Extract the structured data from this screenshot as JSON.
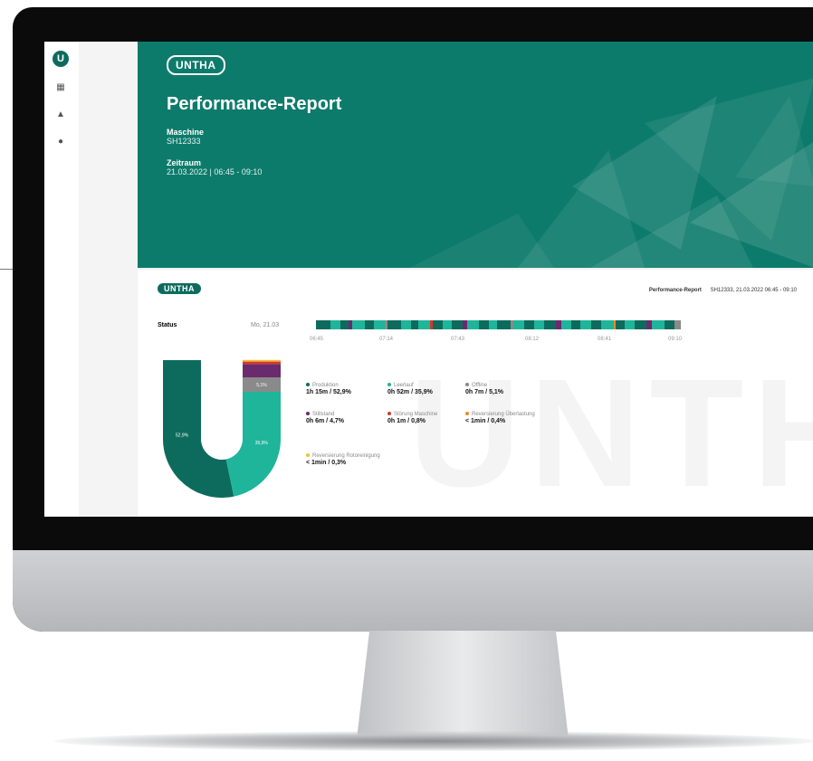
{
  "sidebar": {
    "logo": "U",
    "items": [
      {
        "icon": "grid-icon",
        "glyph": "▦"
      },
      {
        "icon": "bell-icon",
        "glyph": "▲"
      },
      {
        "icon": "help-icon",
        "glyph": "●"
      }
    ]
  },
  "header": {
    "brand": "UNTHA",
    "title": "Performance-Report",
    "machine_label": "Maschine",
    "machine_value": "SH12333",
    "period_label": "Zeitraum",
    "period_value": "21.03.2022 | 06:45 - 09:10"
  },
  "report": {
    "brand": "UNTHA",
    "header_title": "Performance-Report",
    "header_meta": "SH12333, 21.03.2022 06:45 - 09:10",
    "status_label": "Status",
    "status_date": "Mo, 21.03",
    "time_ticks": [
      "06:45",
      "07:14",
      "07:43",
      "08:12",
      "08:41",
      "09:10"
    ],
    "watermark": "UNTH"
  },
  "colors": {
    "produktion": "#0d6b5d",
    "leerlauf": "#1fb59a",
    "offline": "#8a8a8a",
    "stillstand": "#6a2a6e",
    "stoerung": "#d0392b",
    "reversierung_ueberlastung": "#f08a24",
    "reversierung_rotor": "#f2c23a"
  },
  "chart_data": {
    "type": "bar",
    "title": "",
    "segments": [
      {
        "name": "Produktion",
        "duration": "1h 15m",
        "percent": 52.9,
        "label": "52,9%"
      },
      {
        "name": "Leerlauf",
        "duration": "0h 52m",
        "percent": 35.9,
        "label": "35,9%"
      },
      {
        "name": "Offline",
        "duration": "0h 7m",
        "percent": 5.1,
        "label": "5,1%"
      },
      {
        "name": "Stillstand",
        "duration": "0h 6m",
        "percent": 4.7,
        "label": ""
      },
      {
        "name": "Störung Maschine",
        "duration": "0h 1m",
        "percent": 0.8,
        "label": ""
      },
      {
        "name": "Reversierung Überlastung",
        "duration": "< 1min",
        "percent": 0.4,
        "label": ""
      },
      {
        "name": "Reversierung Rotoreinigung",
        "duration": "< 1min",
        "percent": 0.3,
        "label": ""
      }
    ]
  },
  "legend": [
    {
      "name": "Produktion",
      "value": "1h 15m / 52,9%",
      "color_key": "produktion"
    },
    {
      "name": "Leerlauf",
      "value": "0h 52m / 35,9%",
      "color_key": "leerlauf"
    },
    {
      "name": "Offline",
      "value": "0h 7m / 5,1%",
      "color_key": "offline"
    },
    {
      "name": "Stillstand",
      "value": "0h 6m / 4,7%",
      "color_key": "stillstand"
    },
    {
      "name": "Störung Maschine",
      "value": "0h 1m / 0,8%",
      "color_key": "stoerung"
    },
    {
      "name": "Reversierung Überlastung",
      "value": "< 1min / 0,4%",
      "color_key": "reversierung_ueberlastung"
    },
    {
      "name": "Reversierung Rotoreinigung",
      "value": "< 1min / 0,3%",
      "color_key": "reversierung_rotor"
    }
  ]
}
